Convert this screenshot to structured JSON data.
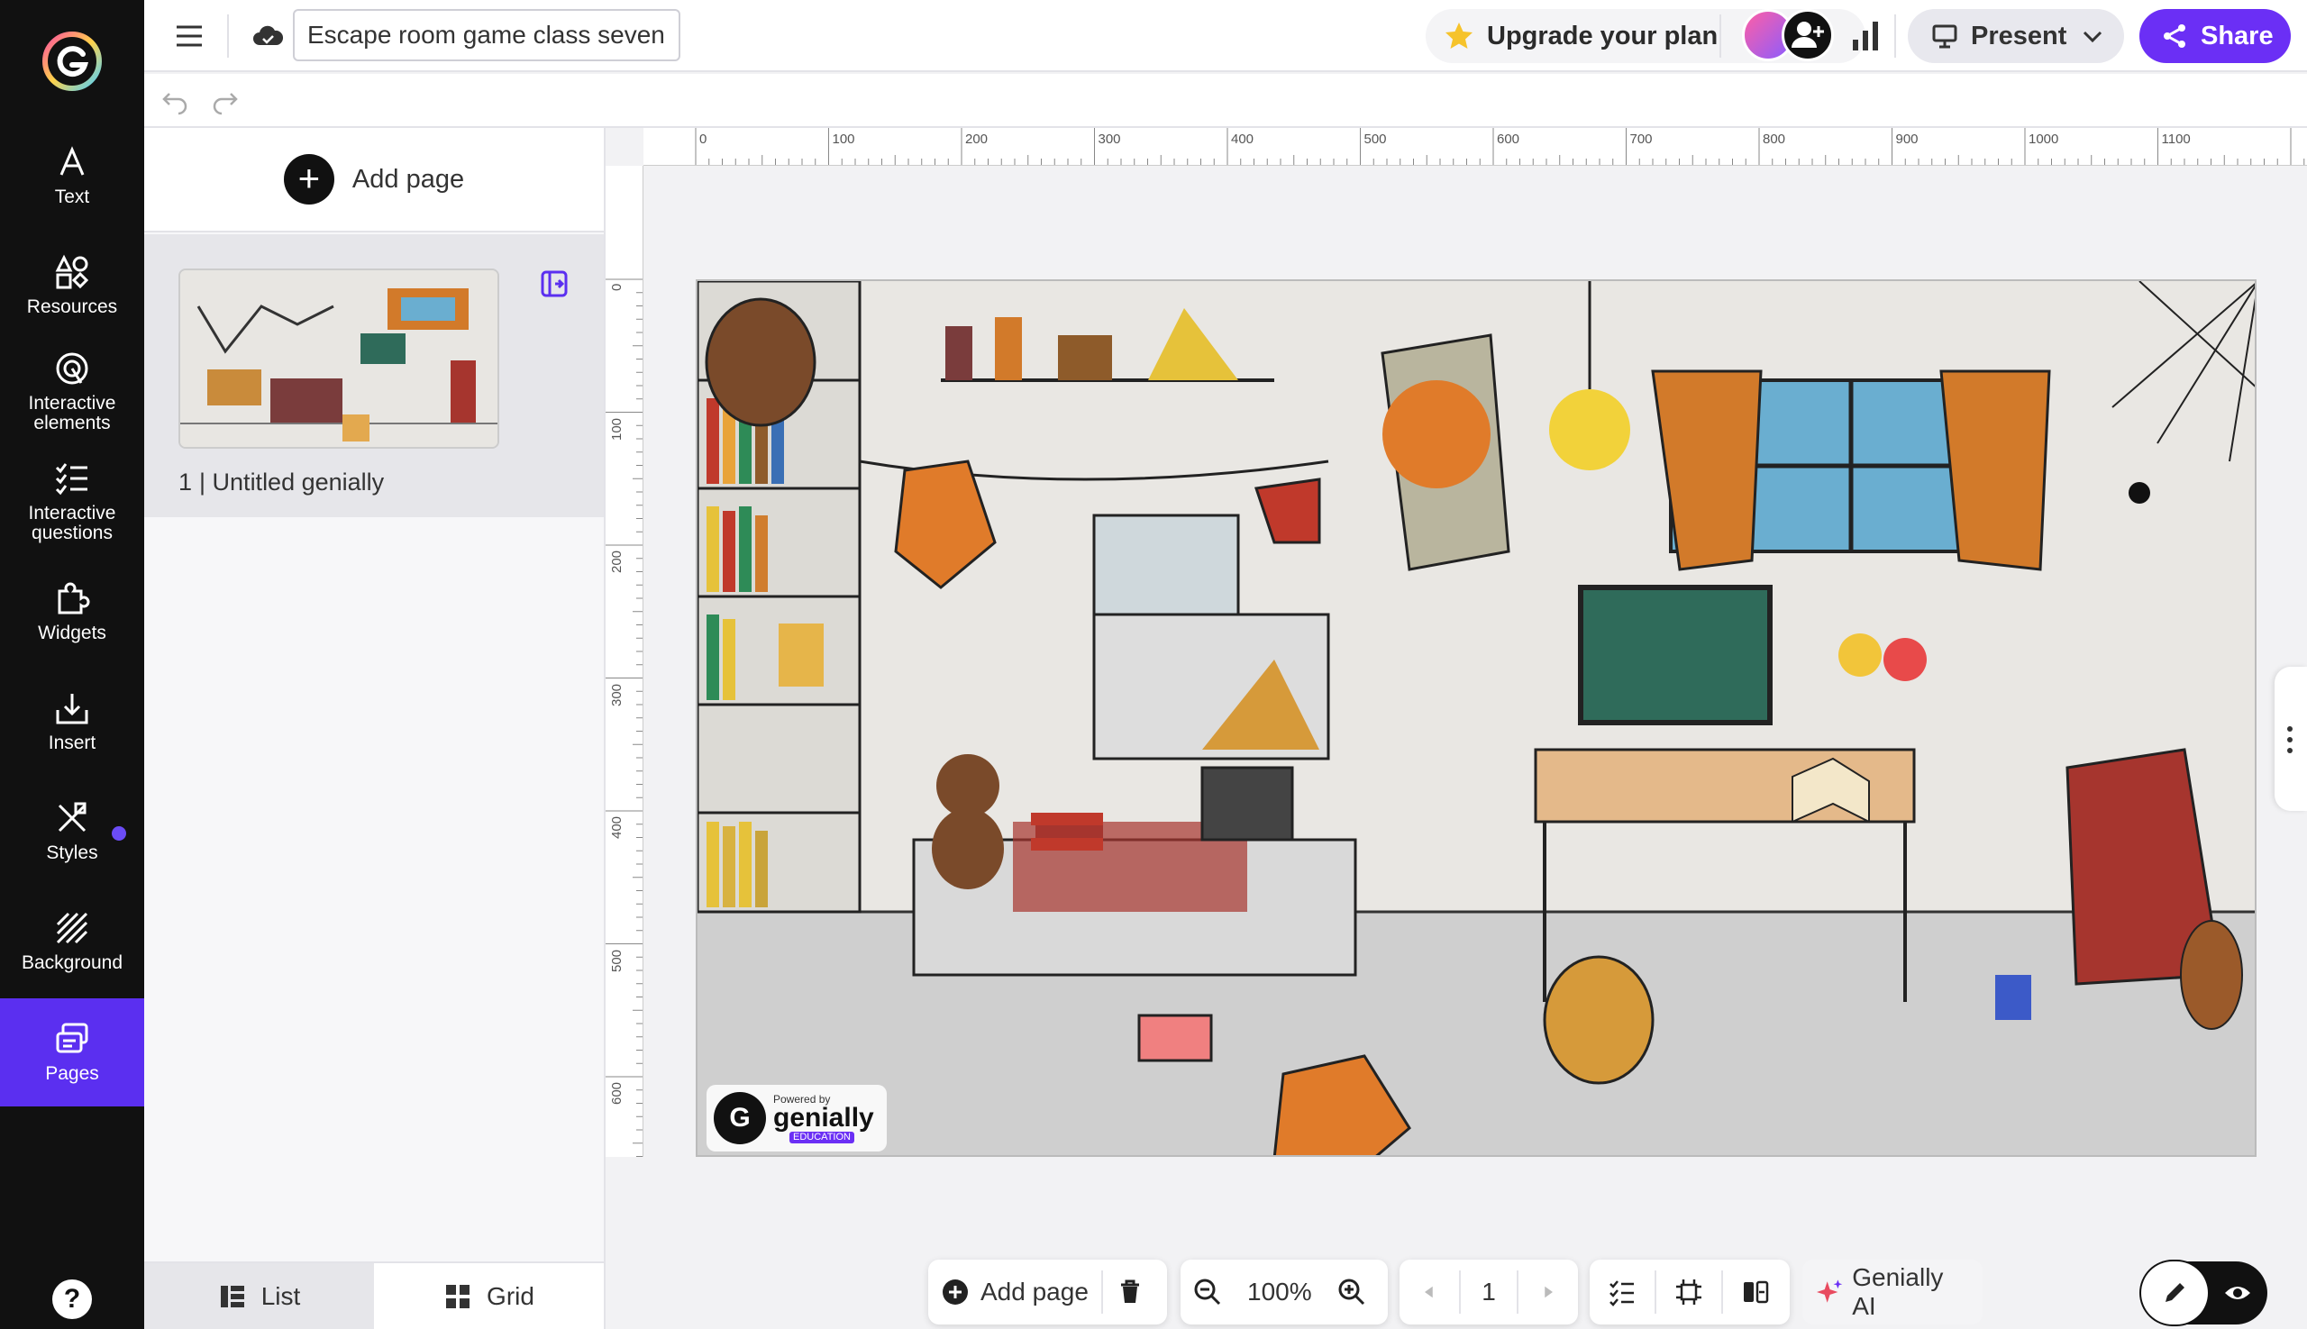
{
  "rail": {
    "items": [
      {
        "label": "Text",
        "icon": "text-icon"
      },
      {
        "label": "Resources",
        "icon": "shapes-icon"
      },
      {
        "label": "Interactive elements",
        "icon": "interactive-icon"
      },
      {
        "label": "Interactive questions",
        "icon": "checklist-icon"
      },
      {
        "label": "Widgets",
        "icon": "puzzle-icon"
      },
      {
        "label": "Insert",
        "icon": "insert-icon"
      },
      {
        "label": "Styles",
        "icon": "styles-icon"
      },
      {
        "label": "Background",
        "icon": "hatch-icon"
      },
      {
        "label": "Pages",
        "icon": "pages-icon"
      }
    ],
    "help_label": "?",
    "accent": "#5b2ff0"
  },
  "topbar": {
    "title_value": "Escape room game class seven",
    "upgrade_label": "Upgrade your plan",
    "present_label": "Present",
    "share_label": "Share"
  },
  "pages_panel": {
    "add_page_label": "Add page",
    "pages": [
      {
        "number": "1",
        "title": "Untitled genially"
      }
    ],
    "list_label": "List",
    "grid_label": "Grid"
  },
  "ruler": {
    "h_labels": [
      "0",
      "100",
      "200",
      "300",
      "400",
      "500",
      "600",
      "700",
      "800",
      "900",
      "1000",
      "1100"
    ],
    "v_labels": [
      "0",
      "100",
      "200",
      "300",
      "400",
      "500",
      "600"
    ]
  },
  "canvas": {
    "badge_powered": "Powered by",
    "badge_name": "genially",
    "badge_edu": "EDUCATION",
    "badge_logo_letter": "G"
  },
  "bottom_toolbar": {
    "add_page_label": "Add page",
    "zoom": "100%",
    "page_number": "1",
    "ai_label": "Genially AI"
  }
}
